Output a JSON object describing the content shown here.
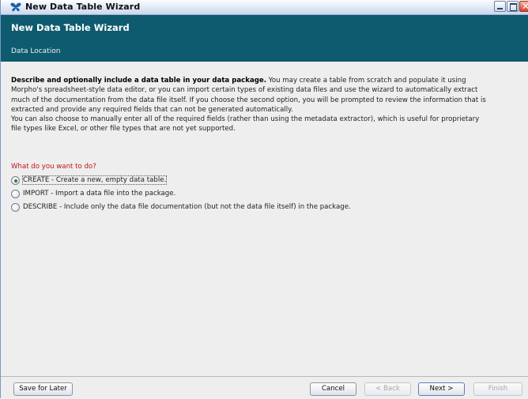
{
  "window": {
    "title": "New Data Table Wizard",
    "app_icon": "morpho-butterfly-icon",
    "controls": [
      "minimize-icon",
      "maximize-icon",
      "close-icon"
    ]
  },
  "header": {
    "title": "New Data Table Wizard",
    "subtitle": "Data Location",
    "background": "#0e5a6e"
  },
  "content": {
    "intro_bold": "Describe and optionally include a data table in your data package.",
    "intro_lines": [
      "You may create a table from scratch and populate it using",
      "Morpho's spreadsheet-style data editor, or you can import certain types of existing data files and use the wizard to automatically extract",
      "much of the documentation from the data file itself. If you choose the second option, you will be prompted to review the information that is",
      "extracted and provide any required fields that can not be generated automatically.",
      "You can also choose to manually enter all of the required fields (rather than using the metadata extractor), which is useful for proprietary",
      "file types like Excel, or other file types that are not yet supported."
    ],
    "question": "What do you want to do?",
    "question_color": "#c0141c",
    "options": [
      {
        "label": "CREATE - Create a new, empty data table.",
        "selected": true
      },
      {
        "label": "IMPORT - Import a data file into the package.",
        "selected": false
      },
      {
        "label": "DESCRIBE - Include only the data file documentation (but not the data file itself) in the package.",
        "selected": false
      }
    ]
  },
  "footer": {
    "save_for_later": "Save for Later",
    "cancel": "Cancel",
    "back": "< Back",
    "next": "Next >",
    "finish": "Finish"
  }
}
